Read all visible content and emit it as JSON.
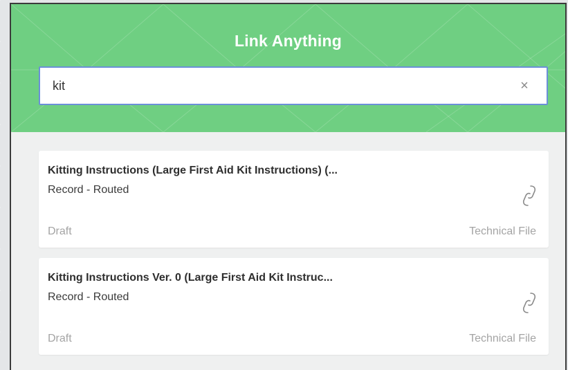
{
  "header": {
    "title": "Link Anything"
  },
  "search": {
    "value": "kit",
    "clear_icon": "close-icon",
    "clear_glyph": "×"
  },
  "results": [
    {
      "title": "Kitting Instructions (Large First Aid Kit Instructions) (...",
      "type": "Record - Routed",
      "status": "Draft",
      "category": "Technical File",
      "icon": "link-icon"
    },
    {
      "title": "Kitting Instructions Ver. 0 (Large First Aid Kit Instruc...",
      "type": "Record - Routed",
      "status": "Draft",
      "category": "Technical File",
      "icon": "link-icon"
    }
  ],
  "colors": {
    "header_green": "#6fcf82",
    "search_border": "#6b8fd8",
    "panel_bg": "#eff0f0"
  }
}
